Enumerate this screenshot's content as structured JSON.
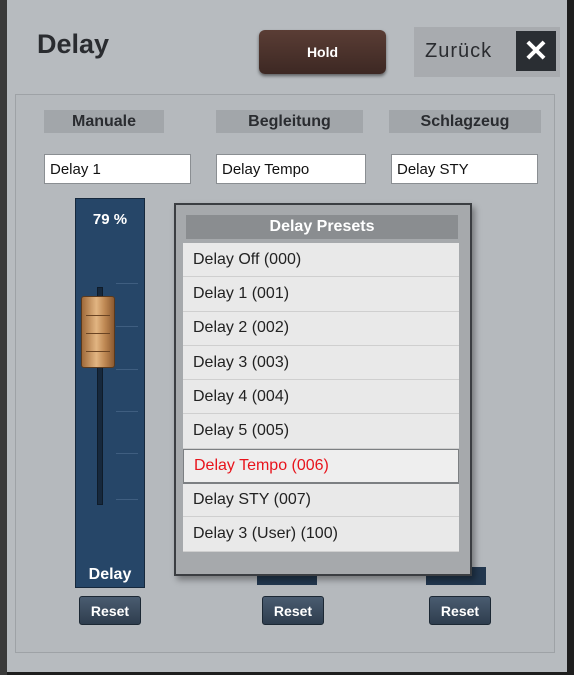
{
  "title": "Delay",
  "hold_label": "Hold",
  "back_label": "Zurück",
  "close_glyph": "✕",
  "sections": [
    {
      "header": "Manuale",
      "value": "Delay 1"
    },
    {
      "header": "Begleitung",
      "value": "Delay Tempo"
    },
    {
      "header": "Schlagzeug",
      "value": "Delay STY"
    }
  ],
  "fader": {
    "percent": "79 %",
    "level": 0.79,
    "label": "Delay"
  },
  "reset_label": "Reset",
  "popup": {
    "title": "Delay Presets",
    "items": [
      "Delay Off (000)",
      "Delay 1 (001)",
      "Delay 2 (002)",
      "Delay 3 (003)",
      "Delay 4 (004)",
      "Delay 5 (005)",
      "Delay Tempo (006)",
      "Delay STY (007)",
      "Delay 3 (User) (100)"
    ],
    "selected_index": 6,
    "selected_color": "#e8141c"
  }
}
